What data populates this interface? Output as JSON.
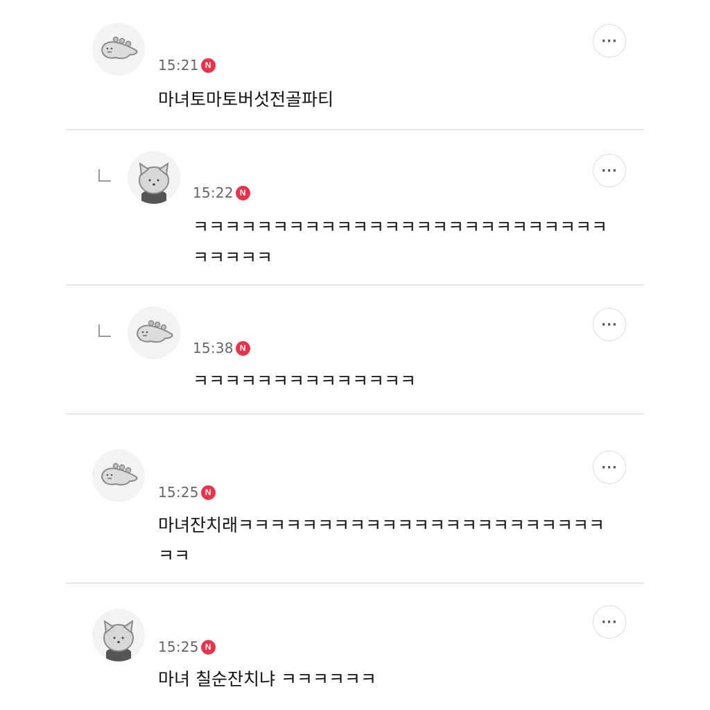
{
  "comments": [
    {
      "avatar": "dino-avatar-icon",
      "time": "15:21",
      "badge": "N",
      "text": "마녀토마토버섯전골파티",
      "reply": false
    },
    {
      "avatar": "cat-avatar-icon",
      "time": "15:22",
      "badge": "N",
      "text": "ㅋㅋㅋㅋㅋㅋㅋㅋㅋㅋㅋㅋㅋㅋㅋㅋㅋㅋㅋㅋㅋㅋㅋㅋㅋㅋㅋㅋㅋㅋㅋ",
      "reply": true
    },
    {
      "avatar": "dino-avatar-icon",
      "time": "15:38",
      "badge": "N",
      "text": "ㅋㅋㅋㅋㅋㅋㅋㅋㅋㅋㅋㅋㅋㅋ",
      "reply": true
    },
    {
      "avatar": "dino-avatar-icon",
      "time": "15:25",
      "badge": "N",
      "text": "마녀잔치래ㅋㅋㅋㅋㅋㅋㅋㅋㅋㅋㅋㅋㅋㅋㅋㅋㅋㅋㅋㅋㅋㅋㅋㅋㅋ",
      "reply": false
    },
    {
      "avatar": "cat-avatar-icon",
      "time": "15:25",
      "badge": "N",
      "text": "마녀 칠순잔치냐 ㅋㅋㅋㅋㅋㅋ",
      "reply": false
    }
  ],
  "more_label": "···"
}
